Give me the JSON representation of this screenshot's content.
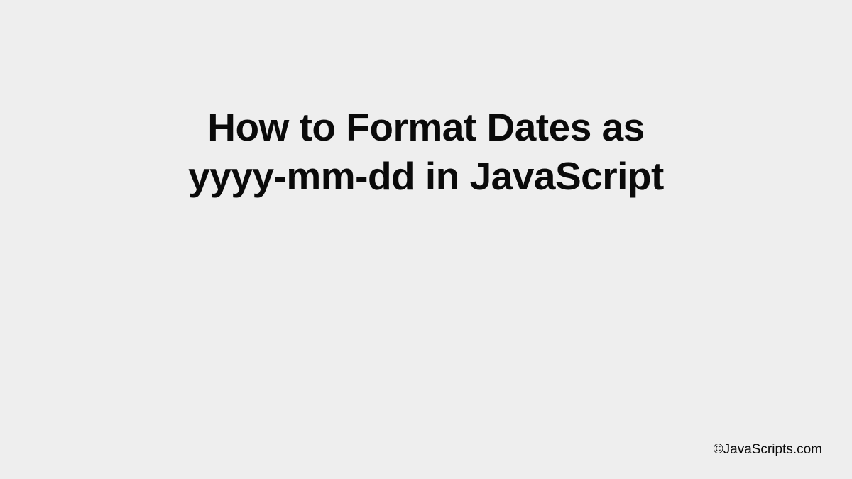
{
  "title": {
    "line1": "How to Format Dates as",
    "line2": "yyyy-mm-dd in JavaScript"
  },
  "footer": {
    "copyright": "©JavaScripts.com"
  }
}
